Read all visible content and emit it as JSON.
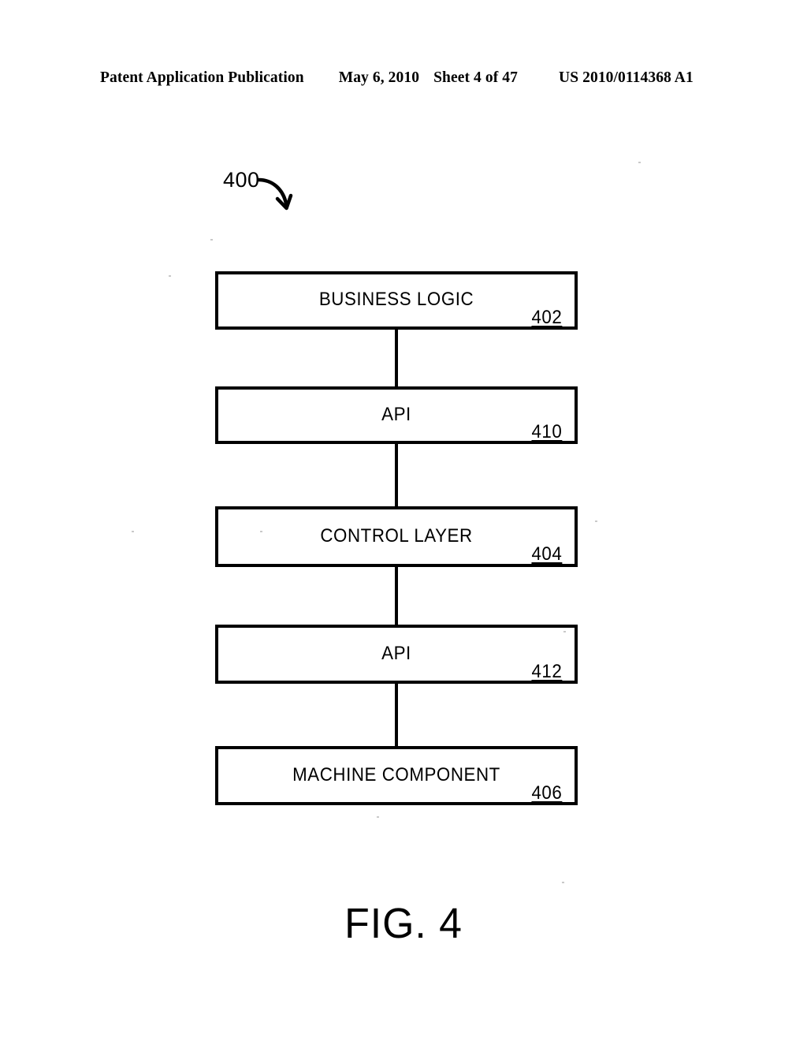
{
  "header": {
    "publication": "Patent Application Publication",
    "date": "May 6, 2010",
    "sheet": "Sheet 4 of 47",
    "patent_number": "US 2010/0114368 A1"
  },
  "figure": {
    "callout_number": "400",
    "caption": "FIG. 4",
    "arrow_icon": "curved-arrow-icon"
  },
  "diagram": {
    "type": "block-stack",
    "boxes": [
      {
        "label": "BUSINESS LOGIC",
        "ref": "402"
      },
      {
        "label": "API",
        "ref": "410"
      },
      {
        "label": "CONTROL LAYER",
        "ref": "404"
      },
      {
        "label": "API",
        "ref": "412"
      },
      {
        "label": "MACHINE COMPONENT",
        "ref": "406"
      }
    ],
    "connectors": [
      {
        "from": "402",
        "to": "410"
      },
      {
        "from": "410",
        "to": "404"
      },
      {
        "from": "404",
        "to": "412"
      },
      {
        "from": "412",
        "to": "406"
      }
    ],
    "colors": {
      "ink": "#000000",
      "background": "#ffffff"
    }
  }
}
